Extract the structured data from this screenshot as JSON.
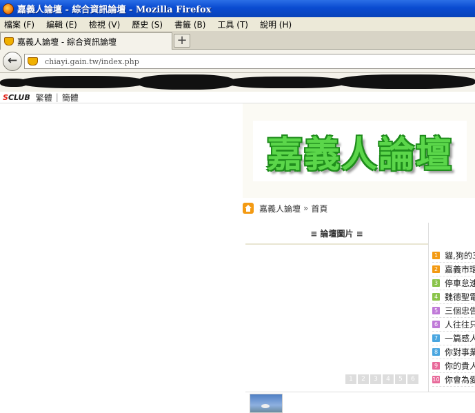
{
  "window": {
    "title": "嘉義人論壇 - 綜合資訊論壇 - Mozilla Firefox"
  },
  "menu": [
    "檔案 (F)",
    "編輯 (E)",
    "檢視 (V)",
    "歷史 (S)",
    "書籤 (B)",
    "工具 (T)",
    "說明 (H)"
  ],
  "tab": {
    "label": "嘉義人論壇 - 綜合資訊論壇",
    "new_tab_label": "+"
  },
  "nav": {
    "back_label": "←",
    "url": "chiayi.gain.tw/index.php"
  },
  "sclub": {
    "logo_s": "S",
    "logo_rest": "CLUB",
    "traditional": "繁體",
    "separator": "|",
    "simplified": "簡體"
  },
  "site": {
    "logo_text": "嘉義人論壇",
    "breadcrumb": {
      "home": "嘉義人論壇",
      "arrow": "»",
      "current": "首頁"
    },
    "pictures_heading": "≡ 論壇圖片 ≡",
    "pager": [
      "1",
      "2",
      "3",
      "4",
      "5",
      "6"
    ],
    "thread_list": [
      {
        "num": "1",
        "title": "貓,狗的3",
        "color": "#f39a13"
      },
      {
        "num": "2",
        "title": "嘉義市環",
        "color": "#f39a13"
      },
      {
        "num": "3",
        "title": "停車怠速",
        "color": "#8ac44a"
      },
      {
        "num": "4",
        "title": "魏德聖電",
        "color": "#8ac44a"
      },
      {
        "num": "5",
        "title": "三個忠告",
        "color": "#c07ad8"
      },
      {
        "num": "6",
        "title": "人往往只",
        "color": "#c07ad8"
      },
      {
        "num": "7",
        "title": "一篇感人",
        "color": "#4aa6e0"
      },
      {
        "num": "8",
        "title": "你對事業",
        "color": "#4aa6e0"
      },
      {
        "num": "9",
        "title": "你的貴人",
        "color": "#e86a9a"
      },
      {
        "num": "10",
        "title": "你會為愛",
        "color": "#e86a9a"
      }
    ]
  }
}
